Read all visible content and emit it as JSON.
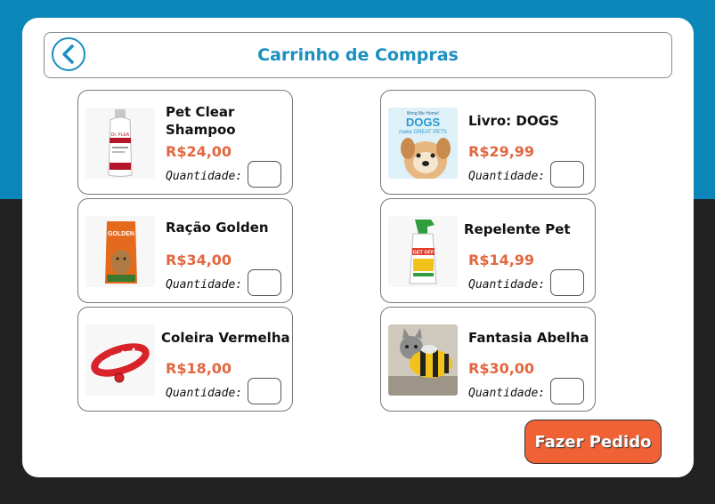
{
  "header": {
    "title": "Carrinho de Compras",
    "back_icon": "chevron-left-icon"
  },
  "colors": {
    "accent": "#1b8fbf",
    "price": "#e2673f",
    "order_button": "#f06236",
    "background_top": "#0a87b8",
    "background_bottom": "#222222"
  },
  "products": [
    {
      "name": "Pet Clear Shampoo",
      "price": "R$24,00",
      "qty_label": "Quantidade:",
      "qty_value": ""
    },
    {
      "name": "Livro: DOGS",
      "price": "R$29,99",
      "qty_label": "Quantidade:",
      "qty_value": ""
    },
    {
      "name": "Ração Golden",
      "price": "R$34,00",
      "qty_label": "Quantidade:",
      "qty_value": ""
    },
    {
      "name": "Repelente Pet",
      "price": "R$14,99",
      "qty_label": "Quantidade:",
      "qty_value": ""
    },
    {
      "name": "Coleira Vermelha",
      "price": "R$18,00",
      "qty_label": "Quantidade:",
      "qty_value": ""
    },
    {
      "name": "Fantasia Abelha",
      "price": "R$30,00",
      "qty_label": "Quantidade:",
      "qty_value": ""
    }
  ],
  "images": {
    "shampoo_brand": "Dr. FLEA",
    "book_cover_line1": "Bring Me Home!",
    "book_cover_title": "DOGS",
    "book_cover_sub": "make GREAT PETS",
    "food_brand": "GOLDEN",
    "repellent_label": "GET OFF"
  },
  "order_button": {
    "label": "Fazer Pedido"
  }
}
